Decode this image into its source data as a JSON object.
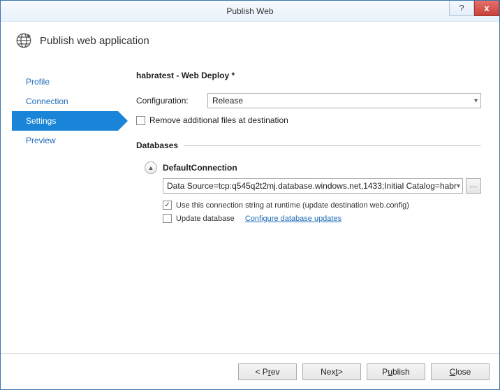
{
  "window": {
    "title": "Publish Web",
    "help_label": "?",
    "close_label": "x"
  },
  "header": {
    "title": "Publish web application"
  },
  "sidebar": {
    "items": [
      {
        "label": "Profile",
        "selected": false
      },
      {
        "label": "Connection",
        "selected": false
      },
      {
        "label": "Settings",
        "selected": true
      },
      {
        "label": "Preview",
        "selected": false
      }
    ]
  },
  "settings": {
    "page_title": "habratest - Web Deploy *",
    "configuration_label": "Configuration:",
    "configuration_value": "Release",
    "remove_files_checked": false,
    "remove_files_label": "Remove additional files at destination",
    "databases": {
      "heading": "Databases",
      "connection": {
        "name": "DefaultConnection",
        "connection_string": "Data Source=tcp:q545q2t2mj.database.windows.net,1433;Initial Catalog=habr",
        "use_runtime_checked": true,
        "use_runtime_label": "Use this connection string at runtime (update destination web.config)",
        "update_db_checked": false,
        "update_db_label": "Update database",
        "configure_link": "Configure database updates"
      }
    }
  },
  "footer": {
    "prev": {
      "left": "< P",
      "u": "r",
      "rest": "ev"
    },
    "next": {
      "left": "Nex",
      "u": "t",
      "rest": " >"
    },
    "publish": {
      "left": "P",
      "u": "u",
      "rest": "blish"
    },
    "close": {
      "left": "",
      "u": "C",
      "rest": "lose"
    }
  }
}
